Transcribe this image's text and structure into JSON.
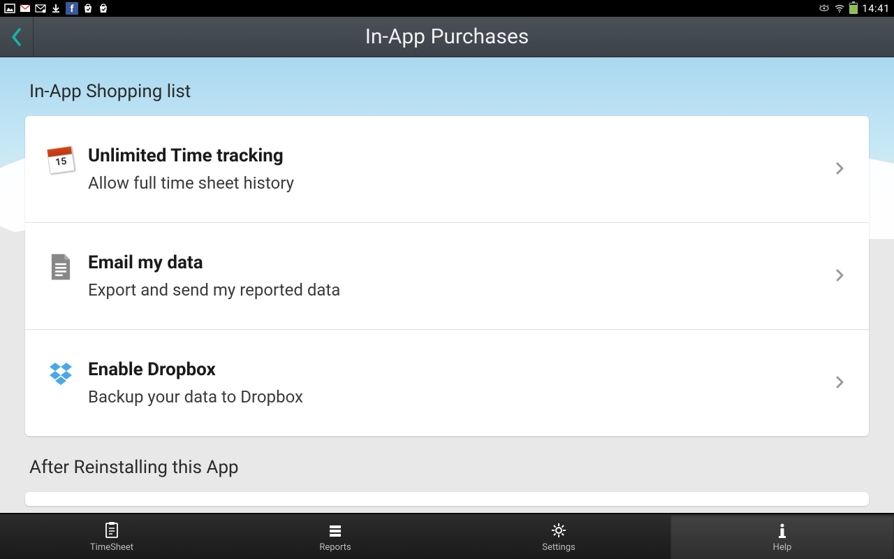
{
  "statusBar": {
    "clock": "14:41"
  },
  "header": {
    "title": "In-App Purchases"
  },
  "sections": [
    {
      "title": "In-App Shopping list",
      "items": [
        {
          "title": "Unlimited Time tracking",
          "subtitle": "Allow full time sheet history",
          "icon": "calendar"
        },
        {
          "title": "Email my data",
          "subtitle": "Export and send my reported data",
          "icon": "document"
        },
        {
          "title": "Enable Dropbox",
          "subtitle": "Backup your data to Dropbox",
          "icon": "dropbox"
        }
      ]
    },
    {
      "title": "After Reinstalling this App",
      "items": []
    }
  ],
  "tabs": [
    {
      "label": "TimeSheet",
      "icon": "timesheet",
      "active": false
    },
    {
      "label": "Reports",
      "icon": "reports",
      "active": false
    },
    {
      "label": "Settings",
      "icon": "settings",
      "active": false
    },
    {
      "label": "Help",
      "icon": "help",
      "active": true
    }
  ]
}
